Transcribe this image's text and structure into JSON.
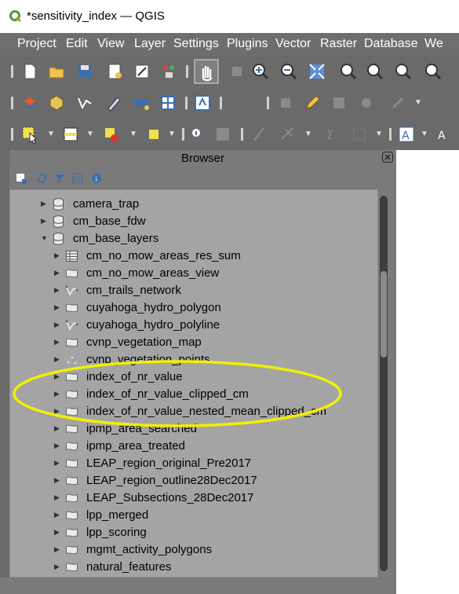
{
  "window": {
    "title": "*sensitivity_index — QGIS",
    "logo_icon": "qgis-logo-icon"
  },
  "menu": [
    "Project",
    "Edit",
    "View",
    "Layer",
    "Settings",
    "Plugins",
    "Vector",
    "Raster",
    "Database",
    "We"
  ],
  "browser": {
    "title": "Browser",
    "close_icon": "close-icon",
    "tools": [
      "add-selected-icon",
      "refresh-icon",
      "filter-icon",
      "collapse-all-icon",
      "properties-icon"
    ]
  },
  "tree_items": [
    {
      "label": "camera_trap",
      "icon": "database-icon",
      "expanded": false
    },
    {
      "label": "cm_base_fdw",
      "icon": "database-icon",
      "expanded": false
    },
    {
      "label": "cm_base_layers",
      "icon": "database-icon",
      "expanded": true
    },
    {
      "label": "cm_no_mow_areas_res_sum",
      "icon": "table-icon",
      "expanded": false
    },
    {
      "label": "cm_no_mow_areas_view",
      "icon": "polygon-layer-icon",
      "expanded": false
    },
    {
      "label": "cm_trails_network",
      "icon": "line-layer-icon",
      "expanded": false
    },
    {
      "label": "cuyahoga_hydro_polygon",
      "icon": "polygon-layer-icon",
      "expanded": false
    },
    {
      "label": "cuyahoga_hydro_polyline",
      "icon": "line-layer-icon",
      "expanded": false
    },
    {
      "label": "cvnp_vegetation_map",
      "icon": "polygon-layer-icon",
      "expanded": false
    },
    {
      "label": "cvnp_vegetation_points",
      "icon": "point-layer-icon",
      "expanded": false
    },
    {
      "label": "index_of_nr_value",
      "icon": "polygon-layer-icon",
      "expanded": false
    },
    {
      "label": "index_of_nr_value_clipped_cm",
      "icon": "polygon-layer-icon",
      "expanded": false
    },
    {
      "label": "index_of_nr_value_nested_mean_clipped_cm",
      "icon": "polygon-layer-icon",
      "expanded": false
    },
    {
      "label": "ipmp_area_searched",
      "icon": "polygon-layer-icon",
      "expanded": false
    },
    {
      "label": "ipmp_area_treated",
      "icon": "polygon-layer-icon",
      "expanded": false
    },
    {
      "label": "LEAP_region_original_Pre2017",
      "icon": "polygon-layer-icon",
      "expanded": false
    },
    {
      "label": "LEAP_region_outline28Dec2017",
      "icon": "polygon-layer-icon",
      "expanded": false
    },
    {
      "label": "LEAP_Subsections_28Dec2017",
      "icon": "polygon-layer-icon",
      "expanded": false
    },
    {
      "label": "lpp_merged",
      "icon": "polygon-layer-icon",
      "expanded": false
    },
    {
      "label": "lpp_scoring",
      "icon": "polygon-layer-icon",
      "expanded": false
    },
    {
      "label": "mgmt_activity_polygons",
      "icon": "polygon-layer-icon",
      "expanded": false
    },
    {
      "label": "natural_features",
      "icon": "polygon-layer-icon",
      "expanded": false
    }
  ],
  "annotation": {
    "type": "yellow-ellipse-highlight",
    "color": "#f0f000"
  }
}
